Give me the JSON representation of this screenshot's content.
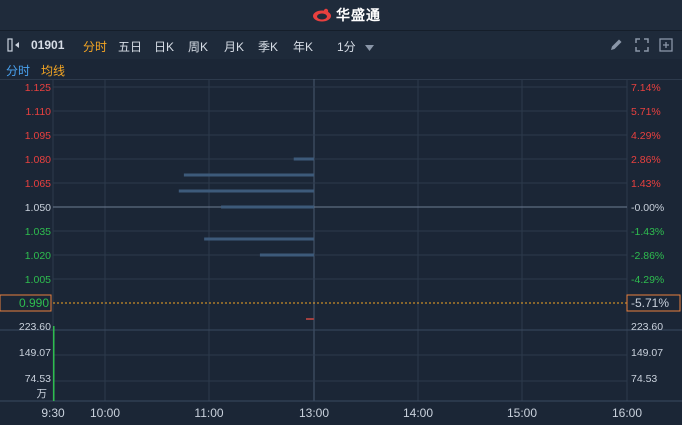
{
  "app": {
    "title": "华盛通"
  },
  "toolbar": {
    "code": "01901",
    "tabs": [
      {
        "label": "分时",
        "active": true
      },
      {
        "label": "五日",
        "active": false
      },
      {
        "label": "日K",
        "active": false
      },
      {
        "label": "周K",
        "active": false
      },
      {
        "label": "月K",
        "active": false
      },
      {
        "label": "季K",
        "active": false
      },
      {
        "label": "年K",
        "active": false
      }
    ],
    "interval": "1分",
    "icons": [
      "collapse-left-icon",
      "pencil-icon",
      "expand-icon",
      "fullscreen-icon"
    ]
  },
  "legend": {
    "primary": "分时",
    "avg": "均线",
    "primary_color": "#4aa3f0",
    "avg_color": "#f5a623"
  },
  "colors": {
    "up": "#e8403f",
    "down": "#2ebd4f",
    "neutral": "#c9d1dc",
    "grid": "#2d3a4c",
    "bar": "#3d5a7a",
    "current": "#f5a623"
  },
  "chart_data": {
    "type": "line",
    "price_axis": {
      "ticks": [
        "1.125",
        "1.110",
        "1.095",
        "1.080",
        "1.065",
        "1.050",
        "1.035",
        "1.020",
        "1.005"
      ],
      "range": [
        0.99,
        1.125
      ],
      "base": 1.05
    },
    "percent_axis": {
      "ticks": [
        "7.14%",
        "5.71%",
        "4.29%",
        "2.86%",
        "1.43%",
        "-0.00%",
        "-1.43%",
        "-2.86%",
        "-4.29%"
      ]
    },
    "current_price": "0.990",
    "current_pct": "-5.71%",
    "volume_axis": {
      "ticks": [
        "223.60",
        "149.07",
        "74.53"
      ],
      "unit": "万",
      "max": 223.6
    },
    "x_axis": {
      "ticks": [
        "9:30",
        "10:00",
        "11:00",
        "13:00",
        "14:00",
        "15:00",
        "16:00"
      ]
    },
    "volume_profile": [
      {
        "price": 1.08,
        "volume": 0.12
      },
      {
        "price": 1.07,
        "volume": 0.77
      },
      {
        "price": 1.06,
        "volume": 0.8
      },
      {
        "price": 1.05,
        "volume": 0.55
      },
      {
        "price": 1.03,
        "volume": 0.65
      },
      {
        "price": 1.02,
        "volume": 0.32
      }
    ],
    "volume_bars": [
      {
        "time": "9:30",
        "value": 223.6
      }
    ]
  }
}
